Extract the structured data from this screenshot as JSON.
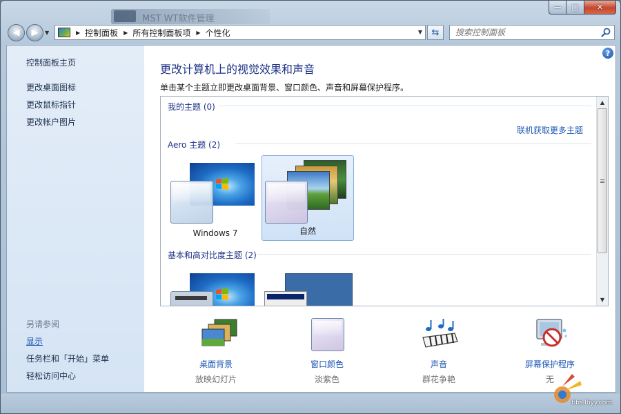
{
  "window": {
    "ghost_title": "MST WT软件管理",
    "caption": {
      "minimize": "—",
      "maximize": "□",
      "close": "✕"
    }
  },
  "address": {
    "breadcrumbs": [
      "控制面板",
      "所有控制面板项",
      "个性化"
    ]
  },
  "search": {
    "placeholder": "搜索控制面板"
  },
  "sidebar": {
    "home": "控制面板主页",
    "links": [
      "更改桌面图标",
      "更改鼠标指针",
      "更改帐户图片"
    ],
    "see_also_title": "另请参阅",
    "see_also": [
      "显示",
      "任务栏和「开始」菜单",
      "轻松访问中心"
    ]
  },
  "main": {
    "title": "更改计算机上的视觉效果和声音",
    "description": "单击某个主题立即更改桌面背景、窗口颜色、声音和屏幕保护程序。"
  },
  "themes": {
    "my_group": "我的主题 (0)",
    "online_link": "联机获取更多主题",
    "aero_group": "Aero 主题 (2)",
    "aero_items": [
      "Windows 7",
      "自然"
    ],
    "selected": "自然",
    "basic_group": "基本和高对比度主题 (2)"
  },
  "bottom": [
    {
      "label": "桌面背景",
      "value": "放映幻灯片",
      "icon": "desktop-background-icon"
    },
    {
      "label": "窗口颜色",
      "value": "淡紫色",
      "icon": "window-color-icon"
    },
    {
      "label": "声音",
      "value": "群花争艳",
      "icon": "sound-icon"
    },
    {
      "label": "屏幕保护程序",
      "value": "无",
      "icon": "screensaver-icon"
    }
  ],
  "watermark": {
    "text": "bbs.lbyy.com"
  },
  "colors": {
    "link": "#1e57b3",
    "title": "#1e3287",
    "sidebar_bg": "#dde9f6",
    "selected_bg": "#d6e6f8"
  }
}
